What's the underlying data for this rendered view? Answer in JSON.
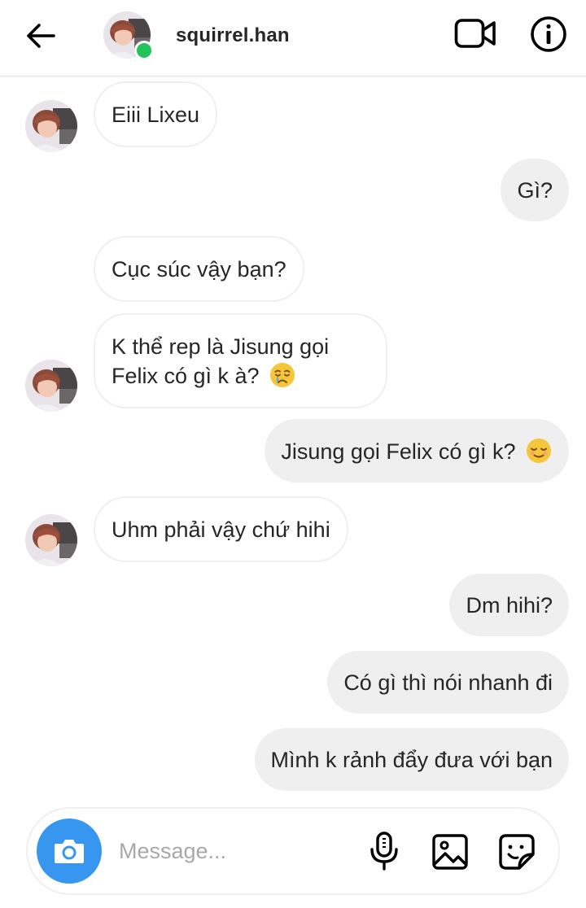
{
  "header": {
    "username": "squirrel.han",
    "back_icon": "arrow-left-icon",
    "video_icon": "video-camera-icon",
    "info_icon": "info-icon",
    "online_color": "#21c45a"
  },
  "messages": [
    {
      "side": "in",
      "lines": [
        "Eiii Lixeu"
      ],
      "emoji": null
    },
    {
      "side": "out",
      "lines": [
        "Gì?"
      ],
      "emoji": null
    },
    {
      "side": "in",
      "lines": [
        "Cục súc vậy bạn?"
      ],
      "emoji": null
    },
    {
      "side": "in",
      "lines": [
        "K thể rep là Jisung gọi",
        "Felix có gì k à?"
      ],
      "emoji": "crying-face-emoji"
    },
    {
      "side": "out",
      "lines": [
        "Jisung gọi Felix có gì k?"
      ],
      "emoji": "relieved-face-emoji"
    },
    {
      "side": "in",
      "lines": [
        "Uhm phải vậy chứ hihi"
      ],
      "emoji": null
    },
    {
      "side": "out",
      "lines": [
        "Dm hihi?"
      ],
      "emoji": null
    },
    {
      "side": "out",
      "lines": [
        "Có gì thì nói nhanh đi"
      ],
      "emoji": null
    },
    {
      "side": "out",
      "lines": [
        "Mình k rảnh đẩy đưa với bạn"
      ],
      "emoji": null
    }
  ],
  "composer": {
    "placeholder": "Message...",
    "value": "",
    "camera_icon": "camera-icon",
    "mic_icon": "microphone-icon",
    "gallery_icon": "image-gallery-icon",
    "sticker_icon": "sticker-icon",
    "accent_color": "#3797f0"
  }
}
